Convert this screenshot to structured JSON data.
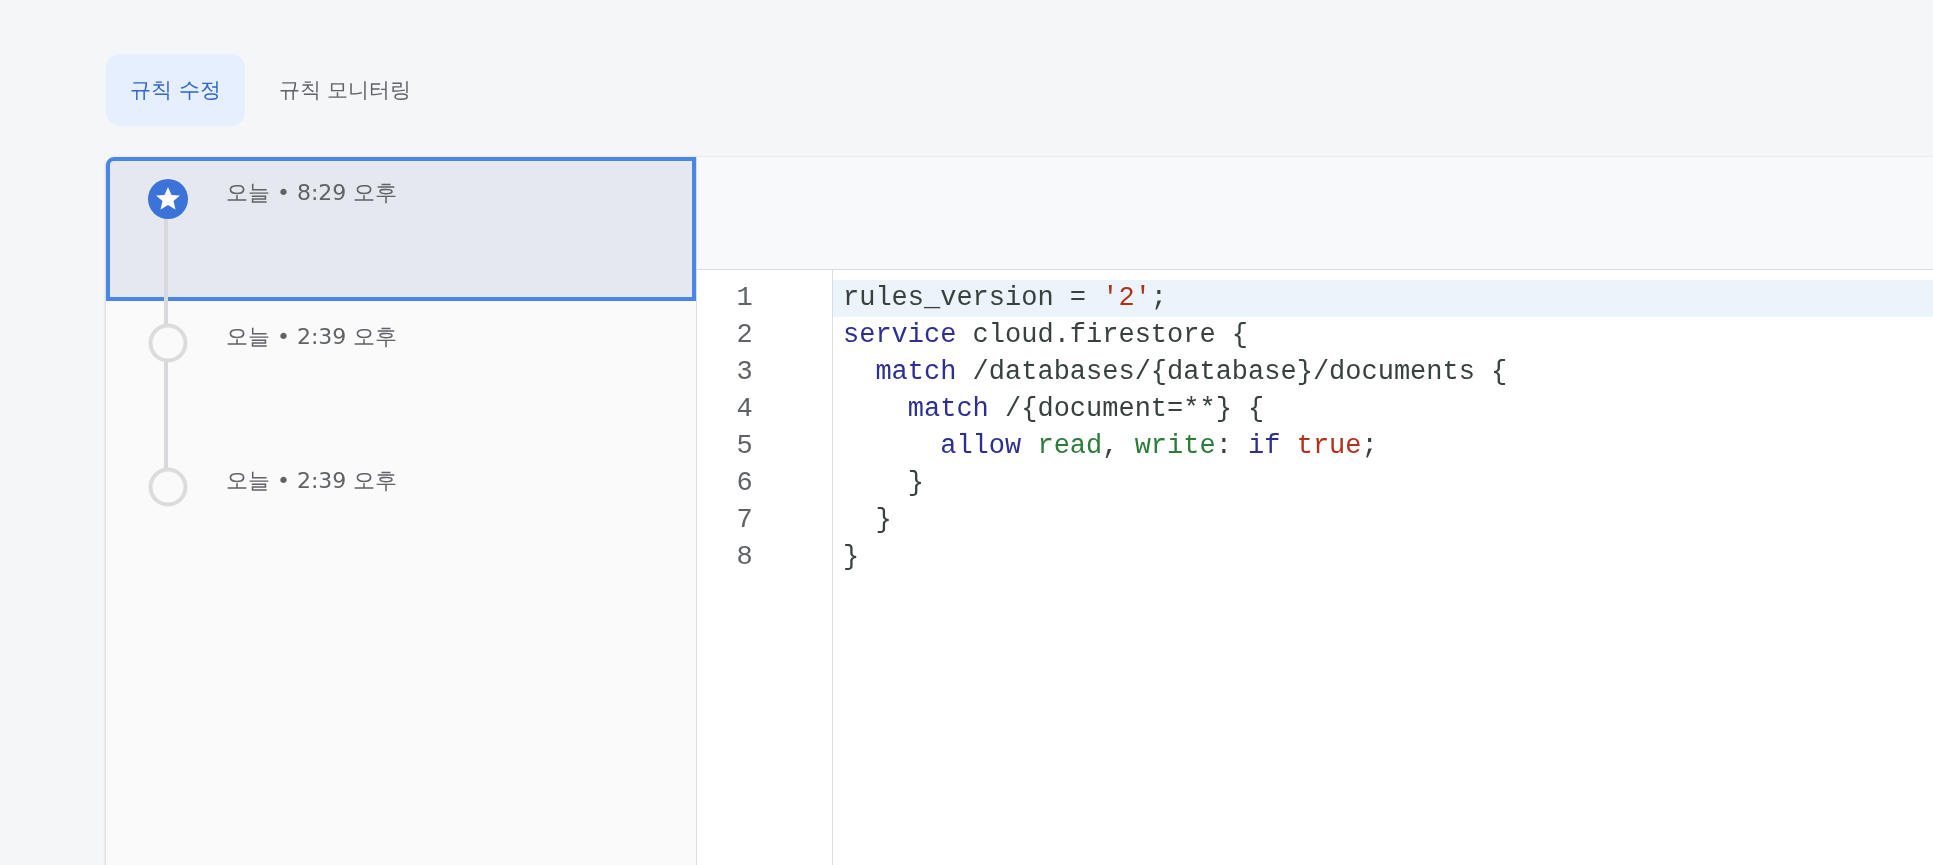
{
  "tabs": [
    {
      "label": "규칙 수정",
      "selected": true
    },
    {
      "label": "규칙 모니터링",
      "selected": false
    }
  ],
  "history": [
    {
      "time": "오늘 • 8:29 오후",
      "current": true,
      "selected": true
    },
    {
      "time": "오늘 • 2:39 오후",
      "current": false,
      "selected": false
    },
    {
      "time": "오늘 • 2:39 오후",
      "current": false,
      "selected": false
    }
  ],
  "editor": {
    "lines": [
      {
        "number": "1",
        "highlighted": true,
        "tokens": [
          {
            "kind": "plain",
            "text": "rules_version = "
          },
          {
            "kind": "literal",
            "text": "'2'"
          },
          {
            "kind": "plain",
            "text": ";"
          }
        ]
      },
      {
        "number": "2",
        "highlighted": false,
        "tokens": [
          {
            "kind": "keyword",
            "text": "service"
          },
          {
            "kind": "plain",
            "text": " cloud.firestore {"
          }
        ]
      },
      {
        "number": "3",
        "highlighted": false,
        "tokens": [
          {
            "kind": "keyword",
            "text": "  match"
          },
          {
            "kind": "plain",
            "text": " /databases/{database}/documents {"
          }
        ]
      },
      {
        "number": "4",
        "highlighted": false,
        "tokens": [
          {
            "kind": "keyword",
            "text": "    match"
          },
          {
            "kind": "plain",
            "text": " /{document=**} {"
          }
        ]
      },
      {
        "number": "5",
        "highlighted": false,
        "tokens": [
          {
            "kind": "keyword",
            "text": "      allow"
          },
          {
            "kind": "ident",
            "text": " read"
          },
          {
            "kind": "plain",
            "text": ", "
          },
          {
            "kind": "ident",
            "text": "write"
          },
          {
            "kind": "plain",
            "text": ": "
          },
          {
            "kind": "keyword",
            "text": "if"
          },
          {
            "kind": "literal",
            "text": " true"
          },
          {
            "kind": "plain",
            "text": ";"
          }
        ]
      },
      {
        "number": "6",
        "highlighted": false,
        "tokens": [
          {
            "kind": "plain",
            "text": "    }"
          }
        ]
      },
      {
        "number": "7",
        "highlighted": false,
        "tokens": [
          {
            "kind": "plain",
            "text": "  }"
          }
        ]
      },
      {
        "number": "8",
        "highlighted": false,
        "tokens": [
          {
            "kind": "plain",
            "text": "}"
          }
        ]
      }
    ]
  }
}
